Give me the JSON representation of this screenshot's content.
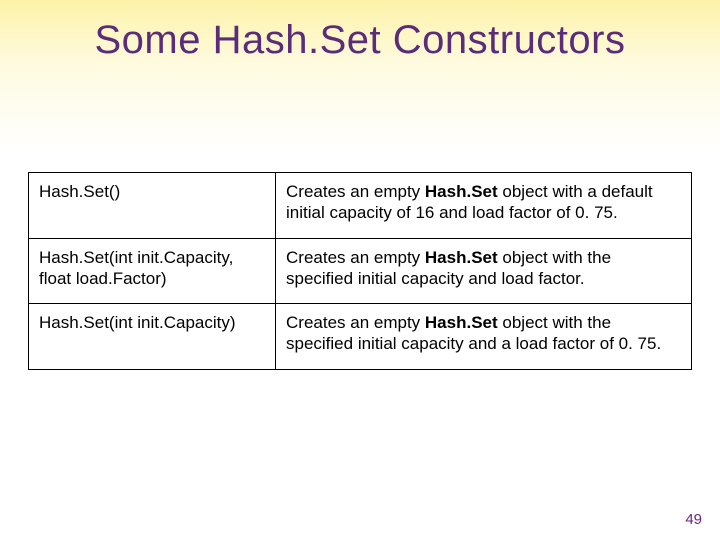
{
  "title": "Some Hash.Set Constructors",
  "rows": [
    {
      "sig": "Hash.Set()",
      "desc_pre": "Creates an empty ",
      "desc_bold": "Hash.Set",
      "desc_post": " object with a default initial capacity of 16 and load factor of 0. 75."
    },
    {
      "sig": "Hash.Set(int init.Capacity, float load.Factor)",
      "desc_pre": "Creates an empty ",
      "desc_bold": "Hash.Set",
      "desc_post": " object with the specified initial capacity and load factor."
    },
    {
      "sig": "Hash.Set(int init.Capacity)",
      "desc_pre": "Creates an empty ",
      "desc_bold": "Hash.Set",
      "desc_post": " object with the specified initial capacity and a load factor of 0. 75."
    }
  ],
  "page_number": "49"
}
